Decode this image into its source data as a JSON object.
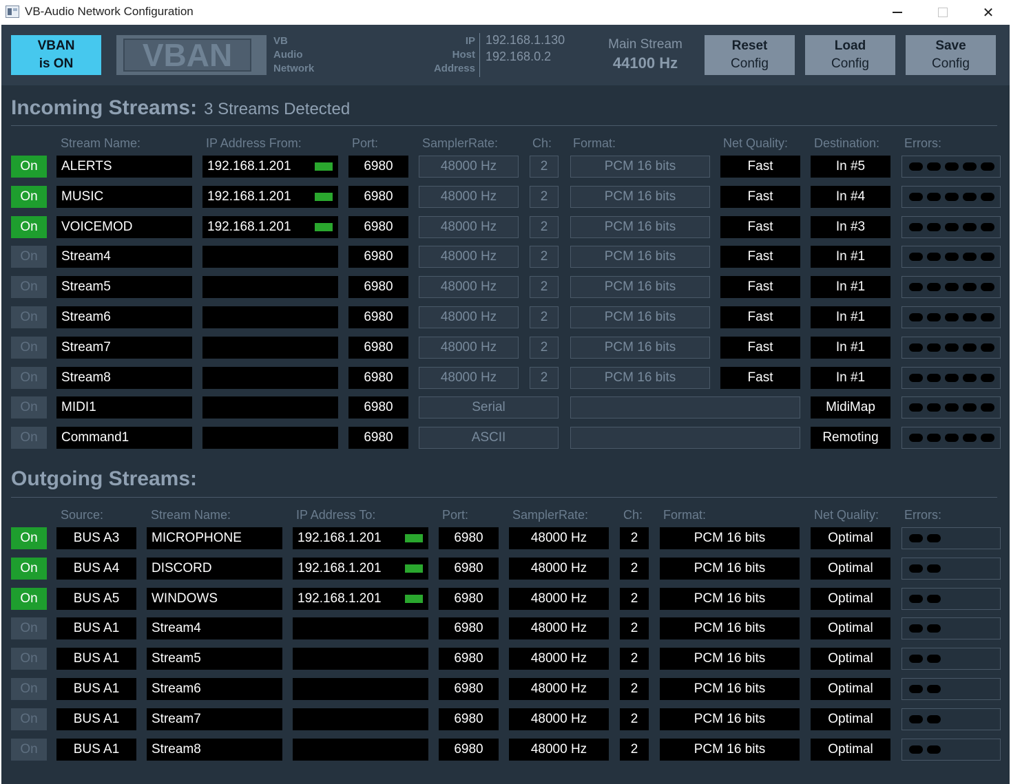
{
  "window": {
    "title": "VB-Audio Network Configuration"
  },
  "header": {
    "vban_status_line1": "VBAN",
    "vban_status_line2": "is ON",
    "logo_text": "VBAN",
    "logo_sub": [
      "VB",
      "Audio",
      "Network"
    ],
    "ip_labels": [
      "IP",
      "Host",
      "Address"
    ],
    "ip_values": [
      "192.168.1.130",
      "192.168.0.2"
    ],
    "main_stream_label": "Main Stream",
    "main_stream_rate": "44100 Hz",
    "buttons": [
      {
        "line1": "Reset",
        "line2": "Config"
      },
      {
        "line1": "Load",
        "line2": "Config"
      },
      {
        "line1": "Save",
        "line2": "Config"
      }
    ]
  },
  "incoming": {
    "title": "Incoming Streams:",
    "subtitle": "3 Streams Detected",
    "headers": [
      "Stream Name:",
      "IP Address From:",
      "Port:",
      "SamplerRate:",
      "Ch:",
      "Format:",
      "Net Quality:",
      "Destination:",
      "Errors:"
    ],
    "rows": [
      {
        "on": "On",
        "active": true,
        "name": "ALERTS",
        "ip": "192.168.1.201",
        "led": true,
        "port": "6980",
        "rate": "48000 Hz",
        "ch": "2",
        "format": "PCM 16 bits",
        "quality": "Fast",
        "dest": "In #5"
      },
      {
        "on": "On",
        "active": true,
        "name": "MUSIC",
        "ip": "192.168.1.201",
        "led": true,
        "port": "6980",
        "rate": "48000 Hz",
        "ch": "2",
        "format": "PCM 16 bits",
        "quality": "Fast",
        "dest": "In #4"
      },
      {
        "on": "On",
        "active": true,
        "name": "VOICEMOD",
        "ip": "192.168.1.201",
        "led": true,
        "port": "6980",
        "rate": "48000 Hz",
        "ch": "2",
        "format": "PCM 16 bits",
        "quality": "Fast",
        "dest": "In #3"
      },
      {
        "on": "On",
        "active": false,
        "name": "Stream4",
        "ip": "",
        "led": false,
        "port": "6980",
        "rate": "48000 Hz",
        "ch": "2",
        "format": "PCM 16 bits",
        "quality": "Fast",
        "dest": "In #1"
      },
      {
        "on": "On",
        "active": false,
        "name": "Stream5",
        "ip": "",
        "led": false,
        "port": "6980",
        "rate": "48000 Hz",
        "ch": "2",
        "format": "PCM 16 bits",
        "quality": "Fast",
        "dest": "In #1"
      },
      {
        "on": "On",
        "active": false,
        "name": "Stream6",
        "ip": "",
        "led": false,
        "port": "6980",
        "rate": "48000 Hz",
        "ch": "2",
        "format": "PCM 16 bits",
        "quality": "Fast",
        "dest": "In #1"
      },
      {
        "on": "On",
        "active": false,
        "name": "Stream7",
        "ip": "",
        "led": false,
        "port": "6980",
        "rate": "48000 Hz",
        "ch": "2",
        "format": "PCM 16 bits",
        "quality": "Fast",
        "dest": "In #1"
      },
      {
        "on": "On",
        "active": false,
        "name": "Stream8",
        "ip": "",
        "led": false,
        "port": "6980",
        "rate": "48000 Hz",
        "ch": "2",
        "format": "PCM 16 bits",
        "quality": "Fast",
        "dest": "In #1"
      },
      {
        "on": "On",
        "active": false,
        "name": "MIDI1",
        "ip": "",
        "led": false,
        "port": "6980",
        "rate": "Serial",
        "ch": "",
        "format": "",
        "quality": "",
        "dest": "MidiMap"
      },
      {
        "on": "On",
        "active": false,
        "name": "Command1",
        "ip": "",
        "led": false,
        "port": "6980",
        "rate": "ASCII",
        "ch": "",
        "format": "",
        "quality": "",
        "dest": "Remoting"
      }
    ]
  },
  "outgoing": {
    "title": "Outgoing Streams:",
    "headers": [
      "Source:",
      "Stream Name:",
      "IP Address To:",
      "Port:",
      "SamplerRate:",
      "Ch:",
      "Format:",
      "Net Quality:",
      "Errors:"
    ],
    "rows": [
      {
        "on": "On",
        "active": true,
        "source": "BUS A3",
        "name": "MICROPHONE",
        "ip": "192.168.1.201",
        "led": true,
        "port": "6980",
        "rate": "48000 Hz",
        "ch": "2",
        "format": "PCM 16 bits",
        "quality": "Optimal"
      },
      {
        "on": "On",
        "active": true,
        "source": "BUS A4",
        "name": "DISCORD",
        "ip": "192.168.1.201",
        "led": true,
        "port": "6980",
        "rate": "48000 Hz",
        "ch": "2",
        "format": "PCM 16 bits",
        "quality": "Optimal"
      },
      {
        "on": "On",
        "active": true,
        "source": "BUS A5",
        "name": "WINDOWS",
        "ip": "192.168.1.201",
        "led": true,
        "port": "6980",
        "rate": "48000 Hz",
        "ch": "2",
        "format": "PCM 16 bits",
        "quality": "Optimal"
      },
      {
        "on": "On",
        "active": false,
        "source": "BUS A1",
        "name": "Stream4",
        "ip": "",
        "led": false,
        "port": "6980",
        "rate": "48000 Hz",
        "ch": "2",
        "format": "PCM 16 bits",
        "quality": "Optimal"
      },
      {
        "on": "On",
        "active": false,
        "source": "BUS A1",
        "name": "Stream5",
        "ip": "",
        "led": false,
        "port": "6980",
        "rate": "48000 Hz",
        "ch": "2",
        "format": "PCM 16 bits",
        "quality": "Optimal"
      },
      {
        "on": "On",
        "active": false,
        "source": "BUS A1",
        "name": "Stream6",
        "ip": "",
        "led": false,
        "port": "6980",
        "rate": "48000 Hz",
        "ch": "2",
        "format": "PCM 16 bits",
        "quality": "Optimal"
      },
      {
        "on": "On",
        "active": false,
        "source": "BUS A1",
        "name": "Stream7",
        "ip": "",
        "led": false,
        "port": "6980",
        "rate": "48000 Hz",
        "ch": "2",
        "format": "PCM 16 bits",
        "quality": "Optimal"
      },
      {
        "on": "On",
        "active": false,
        "source": "BUS A1",
        "name": "Stream8",
        "ip": "",
        "led": false,
        "port": "6980",
        "rate": "48000 Hz",
        "ch": "2",
        "format": "PCM 16 bits",
        "quality": "Optimal"
      }
    ]
  },
  "colors": {
    "accent": "#46c8ee",
    "on_active": "#1e9e2e",
    "led": "#2aa72e",
    "background": "#25323e"
  }
}
